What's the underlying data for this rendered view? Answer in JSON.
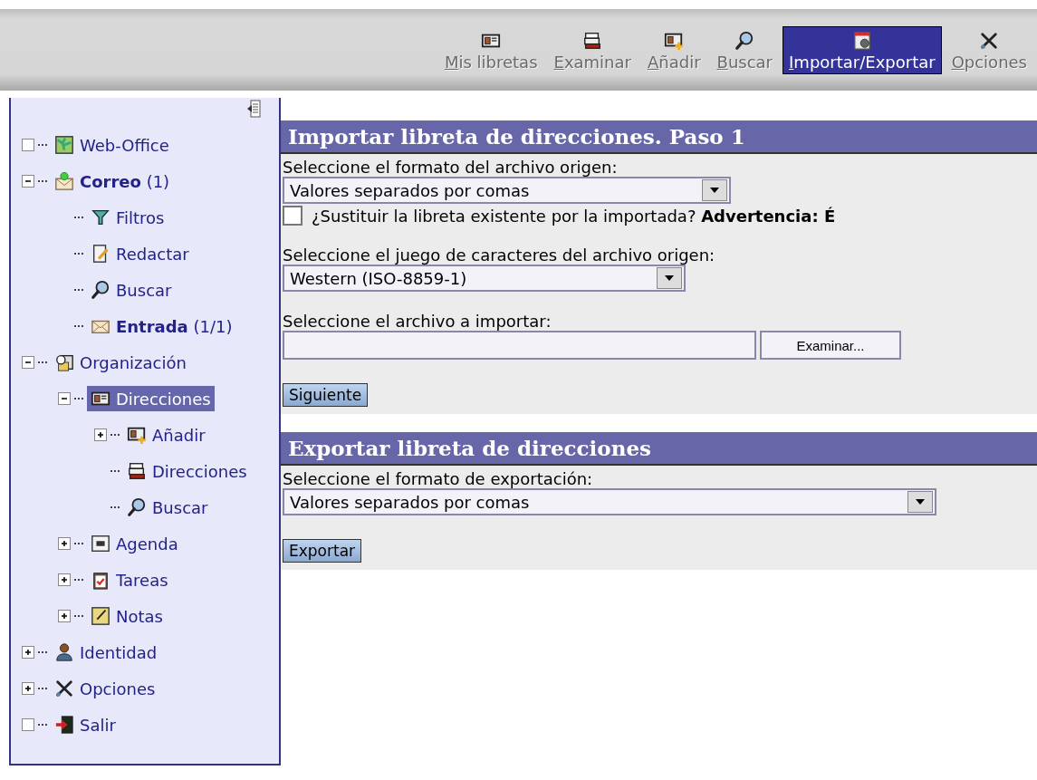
{
  "toolbar": [
    {
      "label": "Mis libretas",
      "kind": "card",
      "selected": false
    },
    {
      "label": "Examinar",
      "kind": "stack",
      "selected": false
    },
    {
      "label": "Añadir",
      "kind": "cardadd",
      "selected": false
    },
    {
      "label": "Buscar",
      "kind": "magnifier",
      "selected": false
    },
    {
      "label": "Importar/Exportar",
      "kind": "import",
      "selected": true
    },
    {
      "label": "Opciones",
      "kind": "tools",
      "selected": false
    }
  ],
  "sidebar": {
    "items": [
      {
        "label": "Web-Office",
        "kind": "map",
        "selected": false
      },
      {
        "label": "**Correo** (1)",
        "kind": "mail",
        "expanded": true,
        "selected": false,
        "children": [
          {
            "label": "Filtros",
            "kind": "filter",
            "selected": false
          },
          {
            "label": "Redactar",
            "kind": "compose",
            "selected": false
          },
          {
            "label": "Buscar",
            "kind": "magnifier",
            "selected": false
          },
          {
            "label": "**Entrada** (1/1)",
            "kind": "envelope",
            "selected": false
          }
        ]
      },
      {
        "label": "Organización",
        "kind": "organizer",
        "expanded": true,
        "selected": false,
        "children": [
          {
            "label": "Direcciones",
            "kind": "card",
            "expanded": true,
            "selected": true,
            "children": [
              {
                "label": "Añadir",
                "kind": "cardadd",
                "expanded": false,
                "selected": false
              },
              {
                "label": "Direcciones",
                "kind": "stack",
                "selected": false
              },
              {
                "label": "Buscar",
                "kind": "magnifier",
                "selected": false
              }
            ]
          },
          {
            "label": "Agenda",
            "kind": "calendar",
            "expanded": false,
            "selected": false
          },
          {
            "label": "Tareas",
            "kind": "clipboard",
            "expanded": false,
            "selected": false
          },
          {
            "label": "Notas",
            "kind": "note",
            "expanded": false,
            "selected": false
          }
        ]
      },
      {
        "label": "Identidad",
        "kind": "person",
        "expanded": false,
        "selected": false
      },
      {
        "label": "Opciones",
        "kind": "tools",
        "expanded": false,
        "selected": false
      },
      {
        "label": "Salir",
        "kind": "exit",
        "selected": false
      }
    ]
  },
  "import": {
    "title": "Importar libreta de direcciones. Paso 1",
    "format_label": "Seleccione el formato del archivo origen:",
    "format_value": "Valores separados por comas",
    "replace": {
      "label": "¿Sustituir la libreta existente por la importada? **Advertencia: É**",
      "checked": false
    },
    "charset_label": "Seleccione el juego de caracteres del archivo origen:",
    "charset_value": "Western (ISO-8859-1)",
    "file_label": "Seleccione el archivo a importar:",
    "browse_button": "Examinar...",
    "next_button": "Siguiente"
  },
  "export": {
    "title": "Exportar libreta de direcciones",
    "format_label": "Seleccione el formato de exportación:",
    "format_value": "Valores separados por comas",
    "export_button": "Exportar"
  }
}
